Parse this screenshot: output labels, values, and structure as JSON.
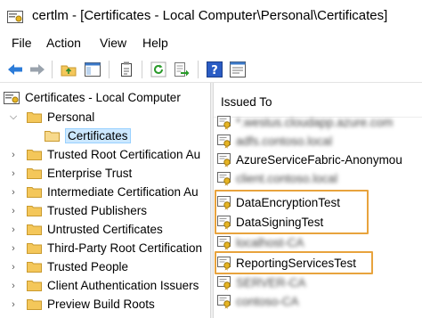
{
  "window": {
    "title": "certlm - [Certificates - Local Computer\\Personal\\Certificates]",
    "title_icon": "certificate-console-icon"
  },
  "menu": [
    "File",
    "Action",
    "View",
    "Help"
  ],
  "toolbar": {
    "icons": [
      "back-arrow-icon",
      "forward-arrow-icon",
      "up-folder-icon",
      "show-hide-tree-icon",
      "copy-icon",
      "refresh-icon",
      "export-list-icon",
      "help-icon",
      "properties-icon"
    ]
  },
  "tree": {
    "root": "Certificates - Local Computer",
    "items": [
      {
        "label": "Personal",
        "expanded": true
      },
      {
        "label": "Certificates",
        "selected": true
      },
      {
        "label": "Trusted Root Certification Au"
      },
      {
        "label": "Enterprise Trust"
      },
      {
        "label": "Intermediate Certification Au"
      },
      {
        "label": "Trusted Publishers"
      },
      {
        "label": "Untrusted Certificates"
      },
      {
        "label": "Third-Party Root Certification"
      },
      {
        "label": "Trusted People"
      },
      {
        "label": "Client Authentication Issuers"
      },
      {
        "label": "Preview Build Roots"
      }
    ]
  },
  "list": {
    "column_header": "Issued To",
    "rows": [
      {
        "text": "*.westus.cloudapp.azure.com",
        "redacted": true
      },
      {
        "text": "adfs.contoso.local",
        "redacted": true
      },
      {
        "text": "AzureServiceFabric-Anonymou",
        "redacted": false
      },
      {
        "text": "client.contoso.local",
        "redacted": true
      },
      {
        "text": "DataEncryptionTest",
        "redacted": false,
        "highlighted": true
      },
      {
        "text": "DataSigningTest",
        "redacted": false,
        "highlighted": true
      },
      {
        "text": "localhost-CA",
        "redacted": true
      },
      {
        "text": "ReportingServicesTest",
        "redacted": false,
        "highlighted": true
      },
      {
        "text": "SERVER-CA",
        "redacted": true
      },
      {
        "text": "contoso-CA",
        "redacted": true
      }
    ]
  },
  "colors": {
    "highlight_border": "#e8a33d",
    "selection_bg": "#cce8ff",
    "folder": "#f4c75a"
  }
}
